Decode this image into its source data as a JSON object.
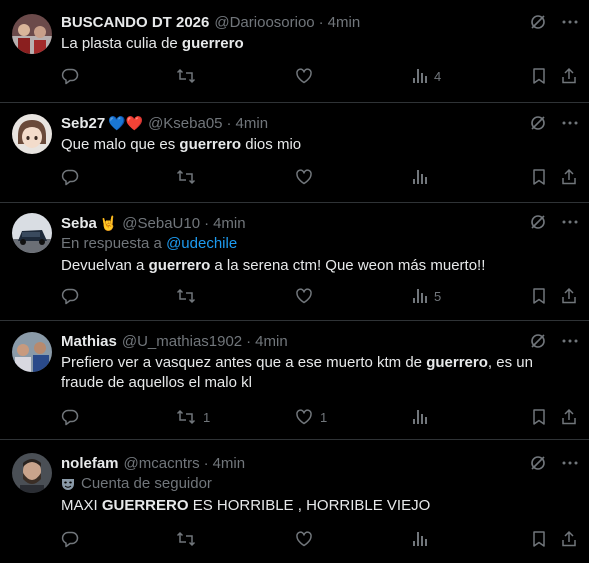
{
  "tweets": [
    {
      "name": "BUSCANDO DT 2026",
      "name_emoji": "",
      "handle": "@Darioosorioo",
      "time": "4min",
      "text_parts": [
        "La plasta culia de ",
        "guerrero",
        ""
      ],
      "reply_count": "",
      "retweet_count": "",
      "like_count": "",
      "view_count": "4"
    },
    {
      "name": "Seb27",
      "name_emoji": "💙❤️",
      "handle": "@Kseba05",
      "time": "4min",
      "text_parts": [
        "Que malo que es ",
        "guerrero",
        " dios mio"
      ],
      "reply_count": "",
      "retweet_count": "",
      "like_count": "",
      "view_count": ""
    },
    {
      "name": "Seba",
      "name_emoji": "🤘",
      "handle": "@SebaU10",
      "time": "4min",
      "reply_prefix": "En respuesta a ",
      "reply_to": "@udechile",
      "text_parts": [
        "Devuelvan a ",
        "guerrero",
        " a la serena ctm! Que weon más muerto!!"
      ],
      "reply_count": "",
      "retweet_count": "",
      "like_count": "",
      "view_count": "5"
    },
    {
      "name": "Mathias",
      "name_emoji": "",
      "handle": "@U_mathias1902",
      "time": "4min",
      "text_line1_parts": [
        "Prefiero ver a vasquez antes que a ese muerto ktm de ",
        "guerrero",
        ", es un"
      ],
      "text_line2": "fraude de aquellos el malo kl",
      "reply_count": "",
      "retweet_count": "1",
      "like_count": "1",
      "view_count": ""
    },
    {
      "name": "nolefam",
      "name_emoji": "",
      "handle": "@mcacntrs",
      "time": "4min",
      "follower_label": "Cuenta de seguidor",
      "text_parts": [
        "MAXI ",
        "GUERRERO",
        " ES HORRIBLE , HORRIBLE VIEJO"
      ],
      "reply_count": "",
      "retweet_count": "",
      "like_count": "",
      "view_count": ""
    }
  ],
  "separator": "·",
  "icons": {
    "grok": "grok-icon",
    "more": "more-icon",
    "reply": "reply-icon",
    "retweet": "retweet-icon",
    "like": "like-icon",
    "views": "views-icon",
    "bookmark": "bookmark-icon",
    "share": "share-icon",
    "follower": "theater-mask-icon"
  },
  "colors": {
    "background": "#000000",
    "text": "#e7e9ea",
    "secondary": "#71767b",
    "link": "#1d9bf0",
    "divider": "#2f3336"
  }
}
